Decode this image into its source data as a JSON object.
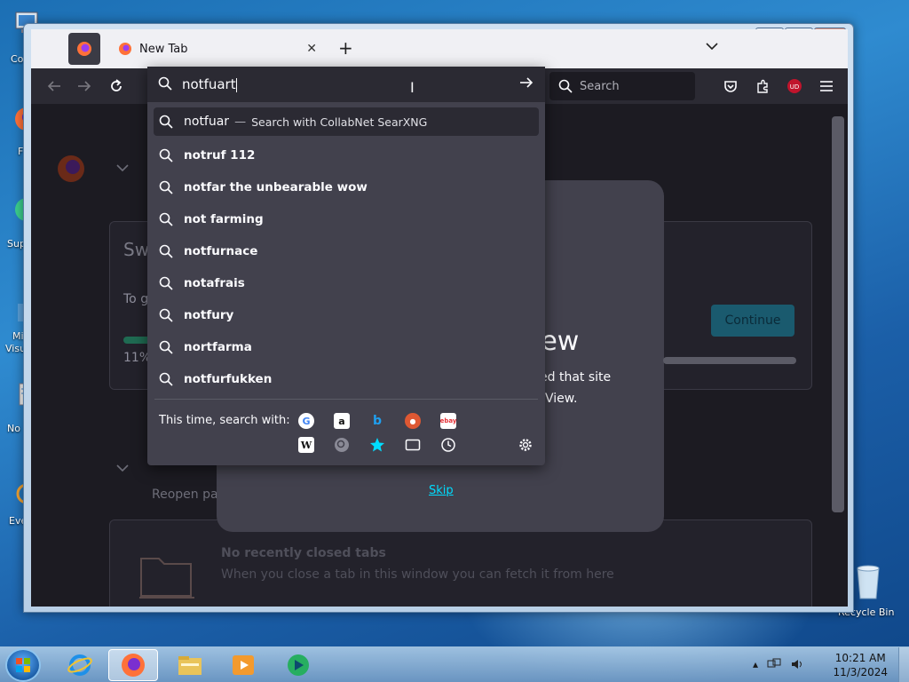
{
  "desktop": {
    "icons": [
      {
        "label": "Co",
        "name": "computer-desktop-icon"
      },
      {
        "label": "F",
        "name": "firefox-desktop-icon"
      },
      {
        "label": "Sup",
        "name": "support-desktop-icon"
      },
      {
        "label": "Mi",
        "label2": "Visu",
        "name": "visual-studio-desktop-icon"
      },
      {
        "label": "No",
        "name": "notepad-desktop-icon"
      },
      {
        "label": "Eve",
        "name": "everything-desktop-icon"
      }
    ],
    "recycle_bin_label": "Recycle Bin"
  },
  "window": {
    "tab_title": "New Tab",
    "controls": {
      "minimize": "▭",
      "maximize": "□",
      "close": "✕"
    }
  },
  "toolbar": {
    "search_placeholder": "Search"
  },
  "urlbar": {
    "typed_text": "notfuart",
    "results": [
      {
        "text": "notfuar",
        "action": "Search with CollabNet SearXNG",
        "selected": true
      },
      {
        "text": "notruf 112"
      },
      {
        "text": "notfar the unbearable wow"
      },
      {
        "text": "not farming"
      },
      {
        "text": "notfurnace"
      },
      {
        "text": "notafrais"
      },
      {
        "text": "notfury"
      },
      {
        "text": "nortfarma"
      },
      {
        "text": "notfurfukken"
      }
    ],
    "search_with_label": "This time, search with:",
    "engines": [
      "Google",
      "Amazon",
      "Bing",
      "DuckDuckGo",
      "eBay",
      "Wikipedia",
      "SearXNG",
      "Bookmarks",
      "Tabs",
      "History"
    ],
    "engine_glyphs": {
      "google": "G",
      "amazon": "a",
      "bing": "b",
      "ddg": "●",
      "ebay": "ebay",
      "wiki": "W"
    }
  },
  "page": {
    "bg_heading": "Sw",
    "bg_subtext": "To g",
    "bg_percent": "11%",
    "modal_title_fragment": "iew",
    "modal_line1_fragment": "ed that site",
    "modal_line2_fragment": "View.",
    "continue_label": "Continue",
    "skip_label": "Skip",
    "reopen_label": "Reopen pa",
    "closed_title": "No recently closed tabs",
    "closed_text": "When you close a tab in this window you can fetch it from here"
  },
  "taskbar": {
    "time": "10:21 AM",
    "date": "11/3/2024"
  },
  "colors": {
    "accent": "#00ddff",
    "toolbar_bg": "#2b2a33",
    "dropdown_bg": "#42414d",
    "content_bg": "#1c1b22"
  }
}
